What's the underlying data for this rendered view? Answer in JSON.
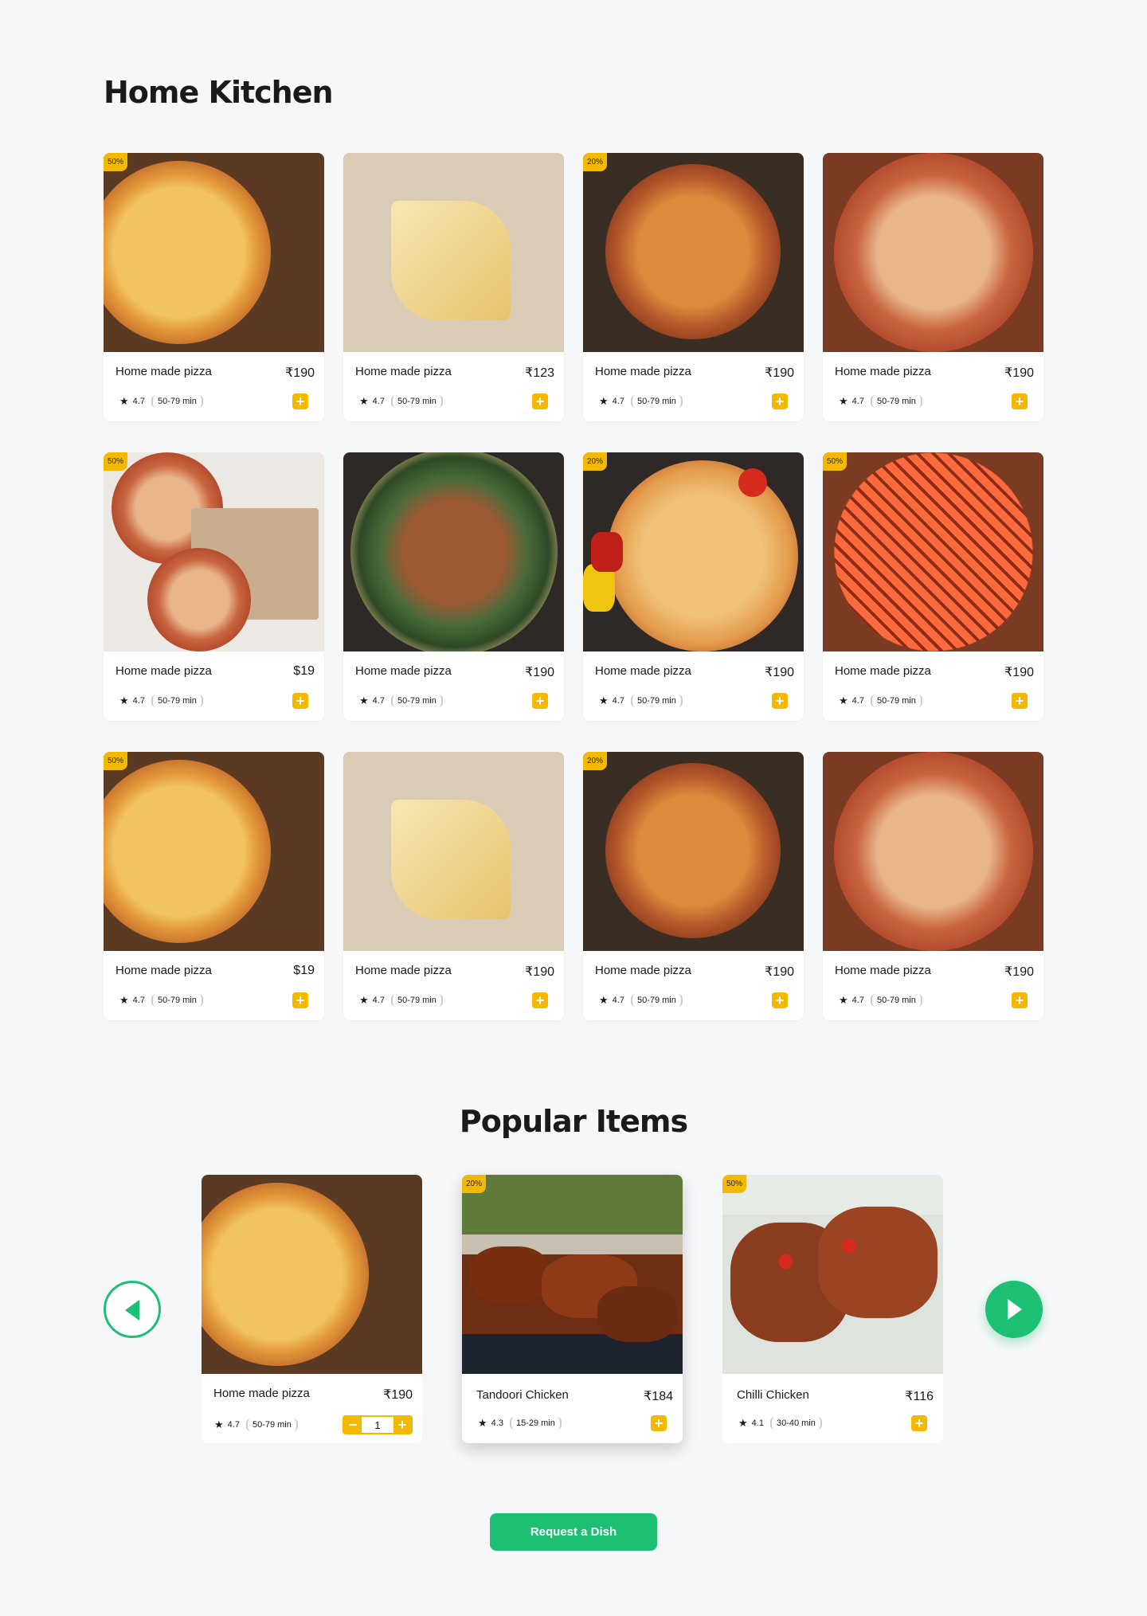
{
  "home_kitchen": {
    "title": "Home Kitchen",
    "items": [
      {
        "name": "Home made pizza",
        "price": "₹190",
        "rating": "4.7",
        "time": "50-79 min",
        "badge": "50%",
        "img": "pizza-board"
      },
      {
        "name": "Home made pizza",
        "price": "₹123",
        "rating": "4.7",
        "time": "50-79 min",
        "badge": "",
        "img": "cheese-slice"
      },
      {
        "name": "Home made pizza",
        "price": "₹190",
        "rating": "4.7",
        "time": "50-79 min",
        "badge": "20%",
        "img": "pizza-sliced"
      },
      {
        "name": "Home made pizza",
        "price": "₹190",
        "rating": "4.7",
        "time": "50-79 min",
        "badge": "",
        "img": "pizza-pan"
      },
      {
        "name": "Home made pizza",
        "price": "$19",
        "rating": "4.7",
        "time": "50-79 min",
        "badge": "50%",
        "img": "pizza-box"
      },
      {
        "name": "Home made pizza",
        "price": "₹190",
        "rating": "4.7",
        "time": "50-79 min",
        "badge": "",
        "img": "pizza-spinach"
      },
      {
        "name": "Home made pizza",
        "price": "₹190",
        "rating": "4.7",
        "time": "50-79 min",
        "badge": "20%",
        "img": "pizza-veggies"
      },
      {
        "name": "Home made pizza",
        "price": "₹190",
        "rating": "4.7",
        "time": "50-79 min",
        "badge": "50%",
        "img": "pizza-bbq"
      },
      {
        "name": "Home made pizza",
        "price": "$19",
        "rating": "4.7",
        "time": "50-79 min",
        "badge": "50%",
        "img": "pizza-board"
      },
      {
        "name": "Home made pizza",
        "price": "₹190",
        "rating": "4.7",
        "time": "50-79 min",
        "badge": "",
        "img": "cheese-slice"
      },
      {
        "name": "Home made pizza",
        "price": "₹190",
        "rating": "4.7",
        "time": "50-79 min",
        "badge": "20%",
        "img": "pizza-sliced"
      },
      {
        "name": "Home made pizza",
        "price": "₹190",
        "rating": "4.7",
        "time": "50-79 min",
        "badge": "",
        "img": "pizza-pan"
      }
    ]
  },
  "popular": {
    "title": "Popular Items",
    "items": [
      {
        "name": "Home made pizza",
        "price": "₹190",
        "rating": "4.7",
        "time": "50-79 min",
        "badge": "",
        "qty": "1",
        "img": "pizza-board"
      },
      {
        "name": "Tandoori Chicken",
        "price": "₹184",
        "rating": "4.3",
        "time": "15-29 min",
        "badge": "20%",
        "img": "tandoori"
      },
      {
        "name": "Chilli Chicken",
        "price": "₹116",
        "rating": "4.1",
        "time": "30-40 min",
        "badge": "50%",
        "img": "chilli"
      }
    ]
  },
  "request_button": "Request a Dish",
  "icons": {
    "star": "star-icon",
    "add": "plus-icon",
    "minus": "minus-icon",
    "prev": "arrow-left-icon",
    "next": "arrow-right-icon"
  },
  "colors": {
    "accent": "#f5b800",
    "primary": "#1dbf73",
    "background": "#f6f7f9"
  }
}
